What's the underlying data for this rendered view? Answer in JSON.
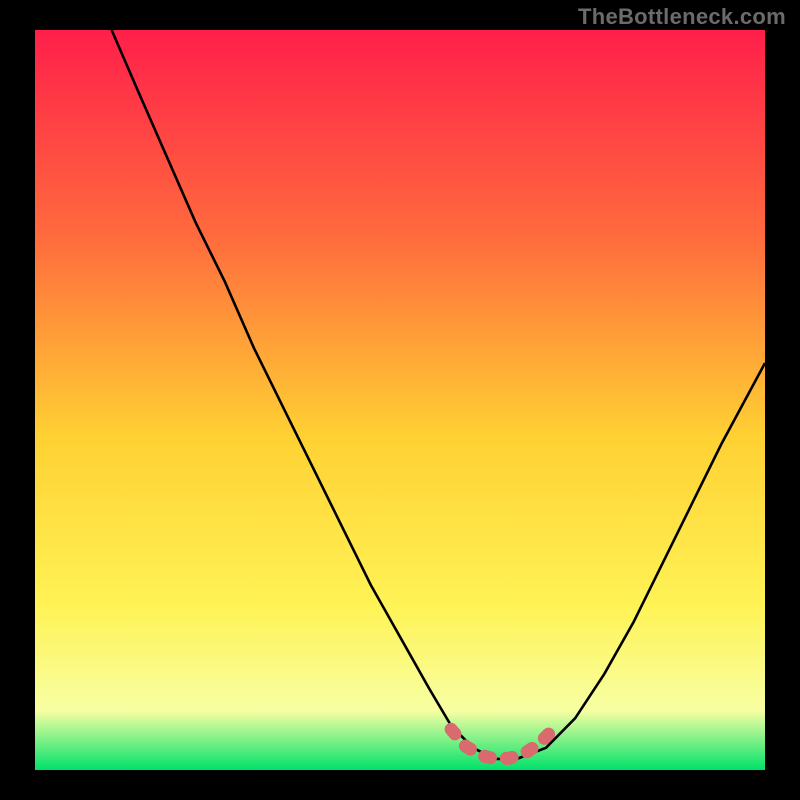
{
  "watermark": "TheBottleneck.com",
  "colors": {
    "bg": "#000000",
    "grad_top": "#ff1f4a",
    "grad_mid1": "#ff6b3d",
    "grad_mid2": "#ffd133",
    "grad_mid3": "#fff356",
    "grad_mid4": "#f7ffa3",
    "grad_bottom": "#00e26a",
    "curve": "#000000",
    "highlight": "#d96a6e"
  },
  "chart_data": {
    "type": "line",
    "title": "",
    "xlabel": "",
    "ylabel": "",
    "xlim": [
      0,
      100
    ],
    "ylim": [
      0,
      100
    ],
    "series": [
      {
        "name": "bottleneck-curve",
        "x": [
          10.5,
          14,
          18,
          22,
          26,
          30,
          34,
          38,
          42,
          46,
          50,
          54,
          57,
          60,
          63,
          66,
          70,
          74,
          78,
          82,
          86,
          90,
          94,
          100
        ],
        "y": [
          100,
          92,
          83,
          74,
          66,
          57,
          49,
          41,
          33,
          25,
          18,
          11,
          6,
          3,
          1.5,
          1.5,
          3,
          7,
          13,
          20,
          28,
          36,
          44,
          55
        ]
      },
      {
        "name": "highlight-range",
        "x": [
          57,
          59,
          61,
          63,
          65,
          67,
          69,
          71
        ],
        "y": [
          5.5,
          3.2,
          2.0,
          1.5,
          1.6,
          2.2,
          3.5,
          5.5
        ]
      }
    ],
    "annotations": []
  }
}
